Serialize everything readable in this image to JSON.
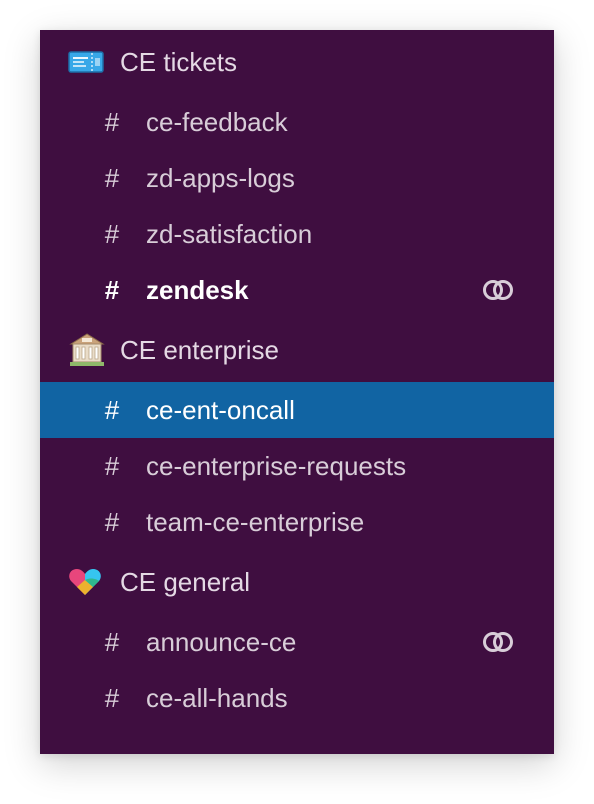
{
  "sections": [
    {
      "title": "CE tickets",
      "icon": "ticket-icon",
      "channels": [
        {
          "name": "ce-feedback",
          "prefix": "#",
          "bold": false,
          "active": false,
          "shared": false
        },
        {
          "name": "zd-apps-logs",
          "prefix": "#",
          "bold": false,
          "active": false,
          "shared": false
        },
        {
          "name": "zd-satisfaction",
          "prefix": "#",
          "bold": false,
          "active": false,
          "shared": false
        },
        {
          "name": "zendesk",
          "prefix": "#",
          "bold": true,
          "active": false,
          "shared": true,
          "shared_icon": "shared-channel-icon"
        }
      ]
    },
    {
      "title": "CE enterprise",
      "icon": "bank-building-icon",
      "channels": [
        {
          "name": "ce-ent-oncall",
          "prefix": "#",
          "bold": false,
          "active": true,
          "shared": false
        },
        {
          "name": "ce-enterprise-requests",
          "prefix": "#",
          "bold": false,
          "active": false,
          "shared": false
        },
        {
          "name": "team-ce-enterprise",
          "prefix": "#",
          "bold": false,
          "active": false,
          "shared": false
        }
      ]
    },
    {
      "title": "CE general",
      "icon": "multicolor-heart-icon",
      "channels": [
        {
          "name": "announce-ce",
          "prefix": "#",
          "bold": false,
          "active": false,
          "shared": true,
          "shared_icon": "shared-channel-icon"
        },
        {
          "name": "ce-all-hands",
          "prefix": "#",
          "bold": false,
          "active": false,
          "shared": false
        }
      ]
    }
  ],
  "colors": {
    "sidebar_bg": "#3f0e40",
    "active_bg": "#1164a3",
    "text": "#d8cdd8",
    "text_bold": "#ffffff"
  }
}
